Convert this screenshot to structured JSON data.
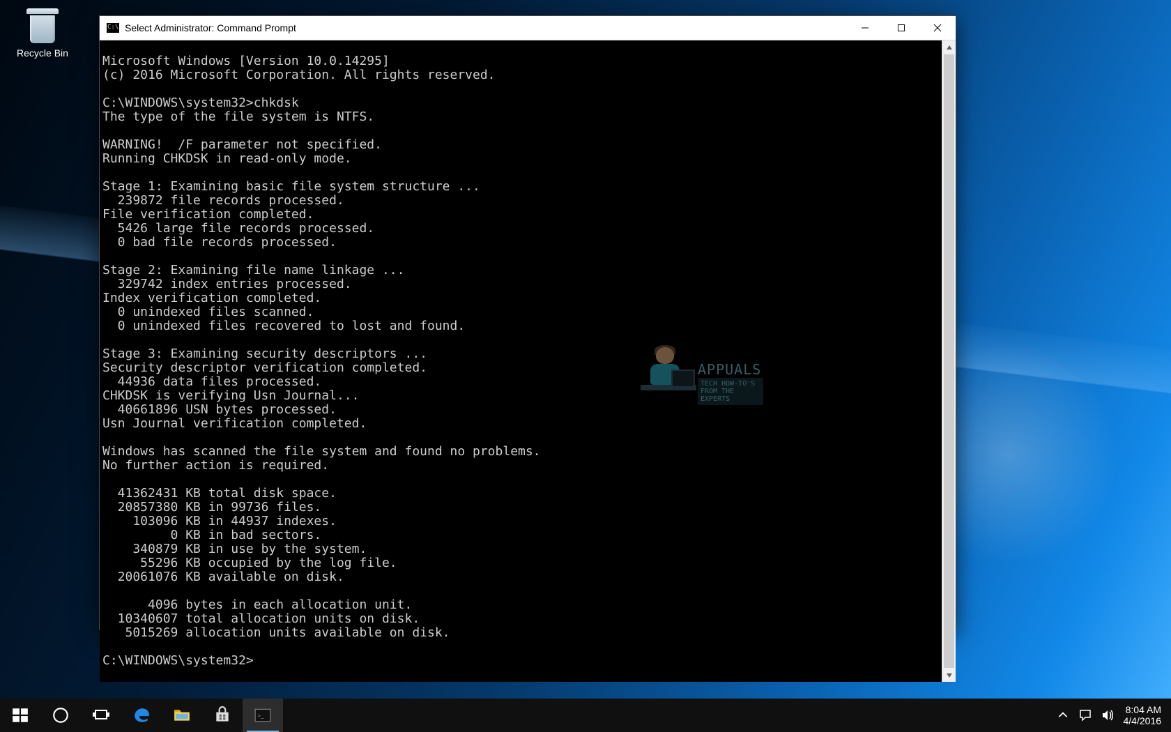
{
  "desktop": {
    "icons": [
      {
        "name": "recycle-bin",
        "label": "Recycle Bin"
      }
    ]
  },
  "window": {
    "title": "Select Administrator: Command Prompt",
    "output_lines": [
      "Microsoft Windows [Version 10.0.14295]",
      "(c) 2016 Microsoft Corporation. All rights reserved.",
      "",
      "C:\\WINDOWS\\system32>chkdsk",
      "The type of the file system is NTFS.",
      "",
      "WARNING!  /F parameter not specified.",
      "Running CHKDSK in read-only mode.",
      "",
      "Stage 1: Examining basic file system structure ...",
      "  239872 file records processed.",
      "File verification completed.",
      "  5426 large file records processed.",
      "  0 bad file records processed.",
      "",
      "Stage 2: Examining file name linkage ...",
      "  329742 index entries processed.",
      "Index verification completed.",
      "  0 unindexed files scanned.",
      "  0 unindexed files recovered to lost and found.",
      "",
      "Stage 3: Examining security descriptors ...",
      "Security descriptor verification completed.",
      "  44936 data files processed.",
      "CHKDSK is verifying Usn Journal...",
      "  40661896 USN bytes processed.",
      "Usn Journal verification completed.",
      "",
      "Windows has scanned the file system and found no problems.",
      "No further action is required.",
      "",
      "  41362431 KB total disk space.",
      "  20857380 KB in 99736 files.",
      "    103096 KB in 44937 indexes.",
      "         0 KB in bad sectors.",
      "    340879 KB in use by the system.",
      "     55296 KB occupied by the log file.",
      "  20061076 KB available on disk.",
      "",
      "      4096 bytes in each allocation unit.",
      "  10340607 total allocation units on disk.",
      "   5015269 allocation units available on disk.",
      "",
      "C:\\WINDOWS\\system32>"
    ]
  },
  "watermark": {
    "brand": "APPUALS",
    "tagline": "TECH HOW-TO'S FROM THE EXPERTS"
  },
  "taskbar": {
    "items": [
      {
        "name": "start",
        "icon": "windows-logo-icon"
      },
      {
        "name": "cortana",
        "icon": "circle-icon"
      },
      {
        "name": "task-view",
        "icon": "task-view-icon"
      },
      {
        "name": "edge",
        "icon": "edge-icon"
      },
      {
        "name": "file-explorer",
        "icon": "folder-icon"
      },
      {
        "name": "store",
        "icon": "store-icon"
      },
      {
        "name": "command-prompt",
        "icon": "terminal-icon",
        "active": true
      }
    ],
    "tray": {
      "time": "8:04 AM",
      "date": "4/4/2016"
    }
  }
}
